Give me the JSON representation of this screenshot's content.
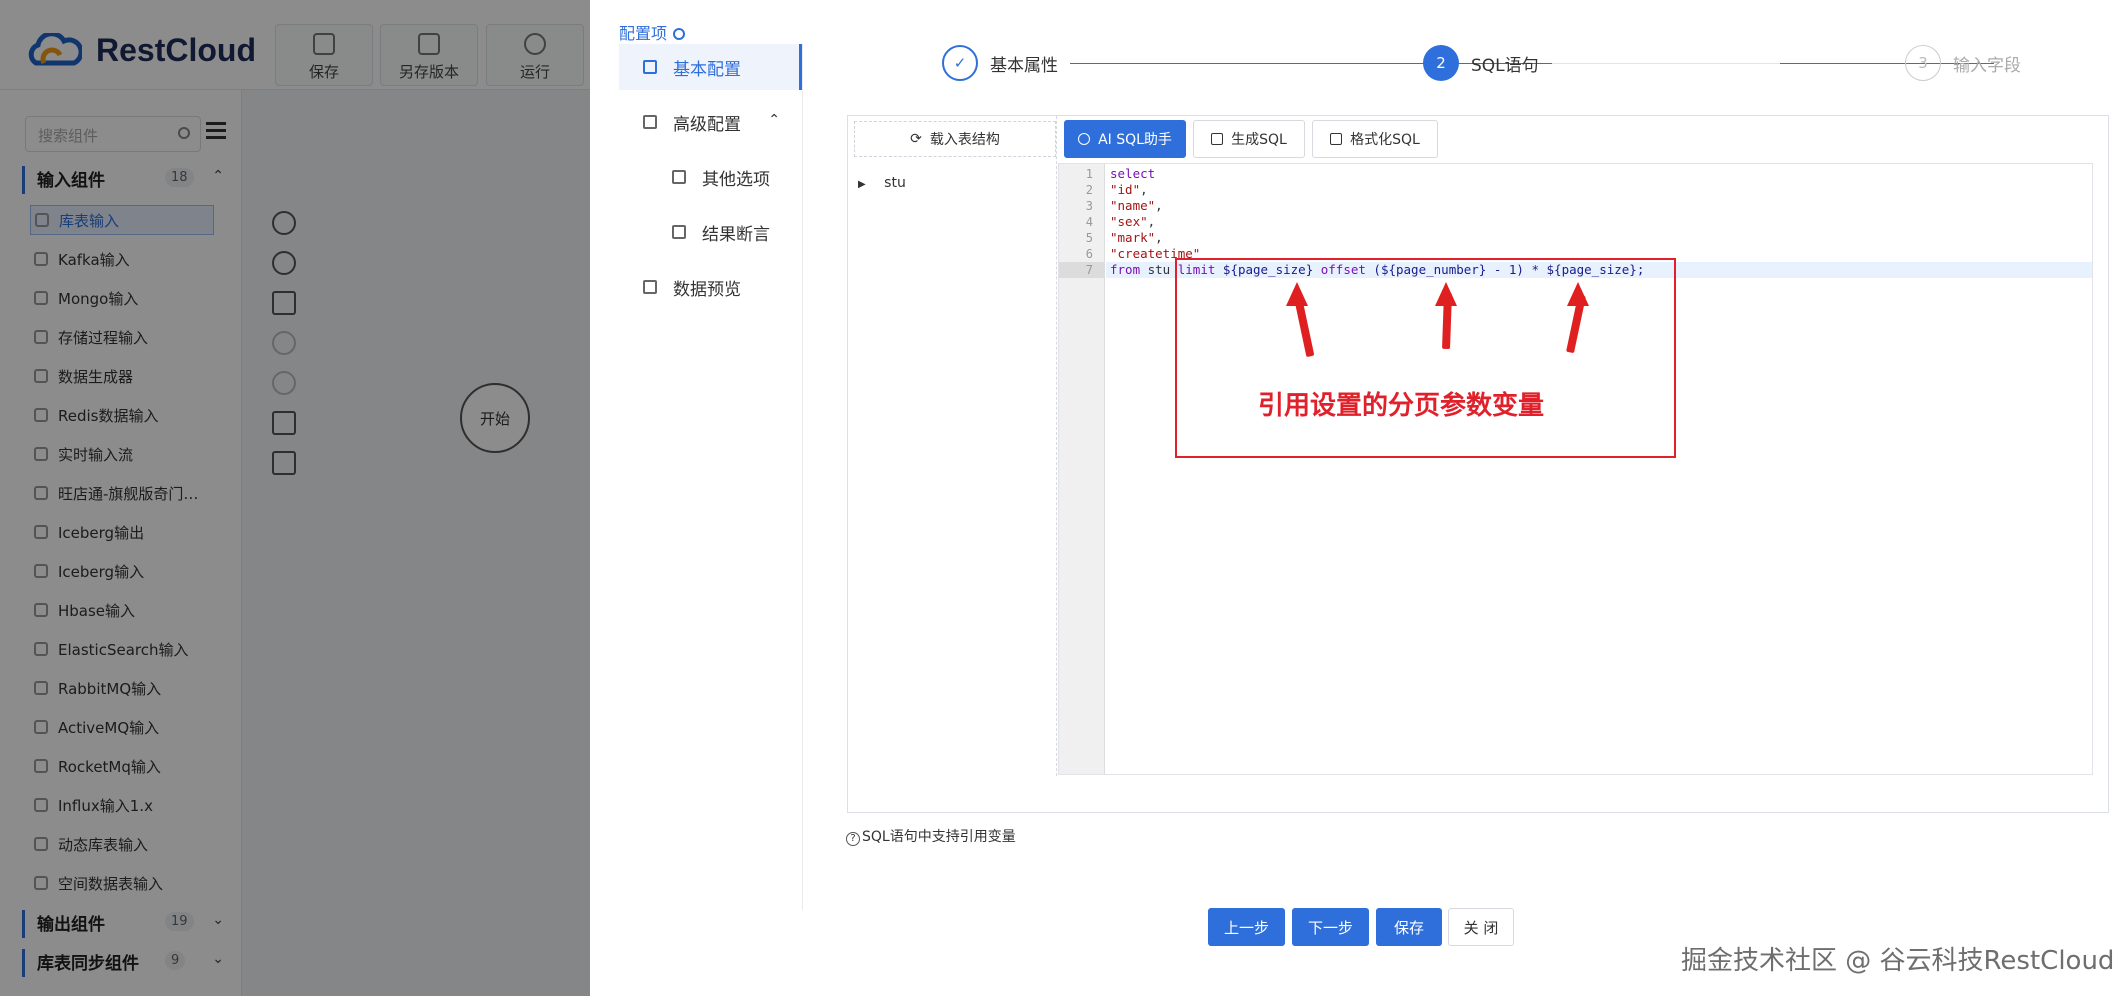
{
  "app": {
    "brand": "RestCloud",
    "toolbar": [
      {
        "label": "保存",
        "icon": "save-icon"
      },
      {
        "label": "另存版本",
        "icon": "copy-icon"
      },
      {
        "label": "运行",
        "icon": "play-icon"
      }
    ],
    "search_placeholder": "搜索组件",
    "groups": [
      {
        "label": "输入组件",
        "count": "18",
        "chevron": "⌃"
      },
      {
        "label": "输出组件",
        "count": "19",
        "chevron": "⌄"
      },
      {
        "label": "库表同步组件",
        "count": "9",
        "chevron": "⌄"
      }
    ],
    "components": [
      "库表输入",
      "Kafka输入",
      "Mongo输入",
      "存储过程输入",
      "数据生成器",
      "Redis数据输入",
      "实时输入流",
      "旺店通-旗舰版奇门…",
      "Iceberg输出",
      "Iceberg输入",
      "Hbase输入",
      "ElasticSearch输入",
      "RabbitMQ输入",
      "ActiveMQ输入",
      "RocketMq输入",
      "Influx输入1.x",
      "动态库表输入",
      "空间数据表输入"
    ],
    "start_node": "开始"
  },
  "drawer": {
    "config_title": "配置项",
    "nav": [
      {
        "label": "基本配置",
        "icon": "grid-icon"
      },
      {
        "label": "高级配置",
        "icon": "cube-icon",
        "arrow": "⌃"
      },
      {
        "label": "其他选项",
        "icon": "grid-icon"
      },
      {
        "label": "结果断言",
        "icon": "grid-icon"
      },
      {
        "label": "数据预览",
        "icon": "table-icon"
      }
    ],
    "steps": [
      {
        "num": "✓",
        "label": "基本属性",
        "state": "done"
      },
      {
        "num": "2",
        "label": "SQL语句",
        "state": "current"
      },
      {
        "num": "3",
        "label": "输入字段",
        "state": "todo"
      }
    ],
    "load_structure": "载入表结构",
    "tree": [
      "stu"
    ],
    "editor_toolbar": {
      "ai": "AI SQL助手",
      "generate": "生成SQL",
      "format": "格式化SQL"
    },
    "code": {
      "line_numbers": [
        "1",
        "2",
        "3",
        "4",
        "5",
        "6",
        "7"
      ],
      "lines": [
        {
          "parts": [
            {
              "t": "select",
              "c": "kw"
            }
          ]
        },
        {
          "parts": [
            {
              "t": "\"id\"",
              "c": "str"
            },
            {
              "t": ",",
              "c": ""
            }
          ]
        },
        {
          "parts": [
            {
              "t": "\"name\"",
              "c": "str"
            },
            {
              "t": ",",
              "c": ""
            }
          ]
        },
        {
          "parts": [
            {
              "t": "\"sex\"",
              "c": "str"
            },
            {
              "t": ",",
              "c": ""
            }
          ]
        },
        {
          "parts": [
            {
              "t": "\"mark\"",
              "c": "str"
            },
            {
              "t": ",",
              "c": ""
            }
          ]
        },
        {
          "parts": [
            {
              "t": "\"createtime\"",
              "c": "str"
            }
          ]
        },
        {
          "parts": [
            {
              "t": "from",
              "c": "kw"
            },
            {
              "t": " stu ",
              "c": ""
            },
            {
              "t": "limit",
              "c": "kw"
            },
            {
              "t": " ${page_size} ",
              "c": "tok"
            },
            {
              "t": "offset",
              "c": "kw"
            },
            {
              "t": " (${page_number} - 1) * ${page_size};",
              "c": "tok"
            }
          ]
        }
      ]
    },
    "annotation": "引用设置的分页参数变量",
    "hint": "SQL语句中支持引用变量",
    "footer": {
      "prev": "上一步",
      "next": "下一步",
      "save": "保存",
      "close": "关 闭"
    },
    "watermark": "掘金技术社区 @ 谷云科技RestCloud"
  },
  "colors": {
    "primary": "#2f6fdb",
    "annotation": "#e0202a"
  }
}
